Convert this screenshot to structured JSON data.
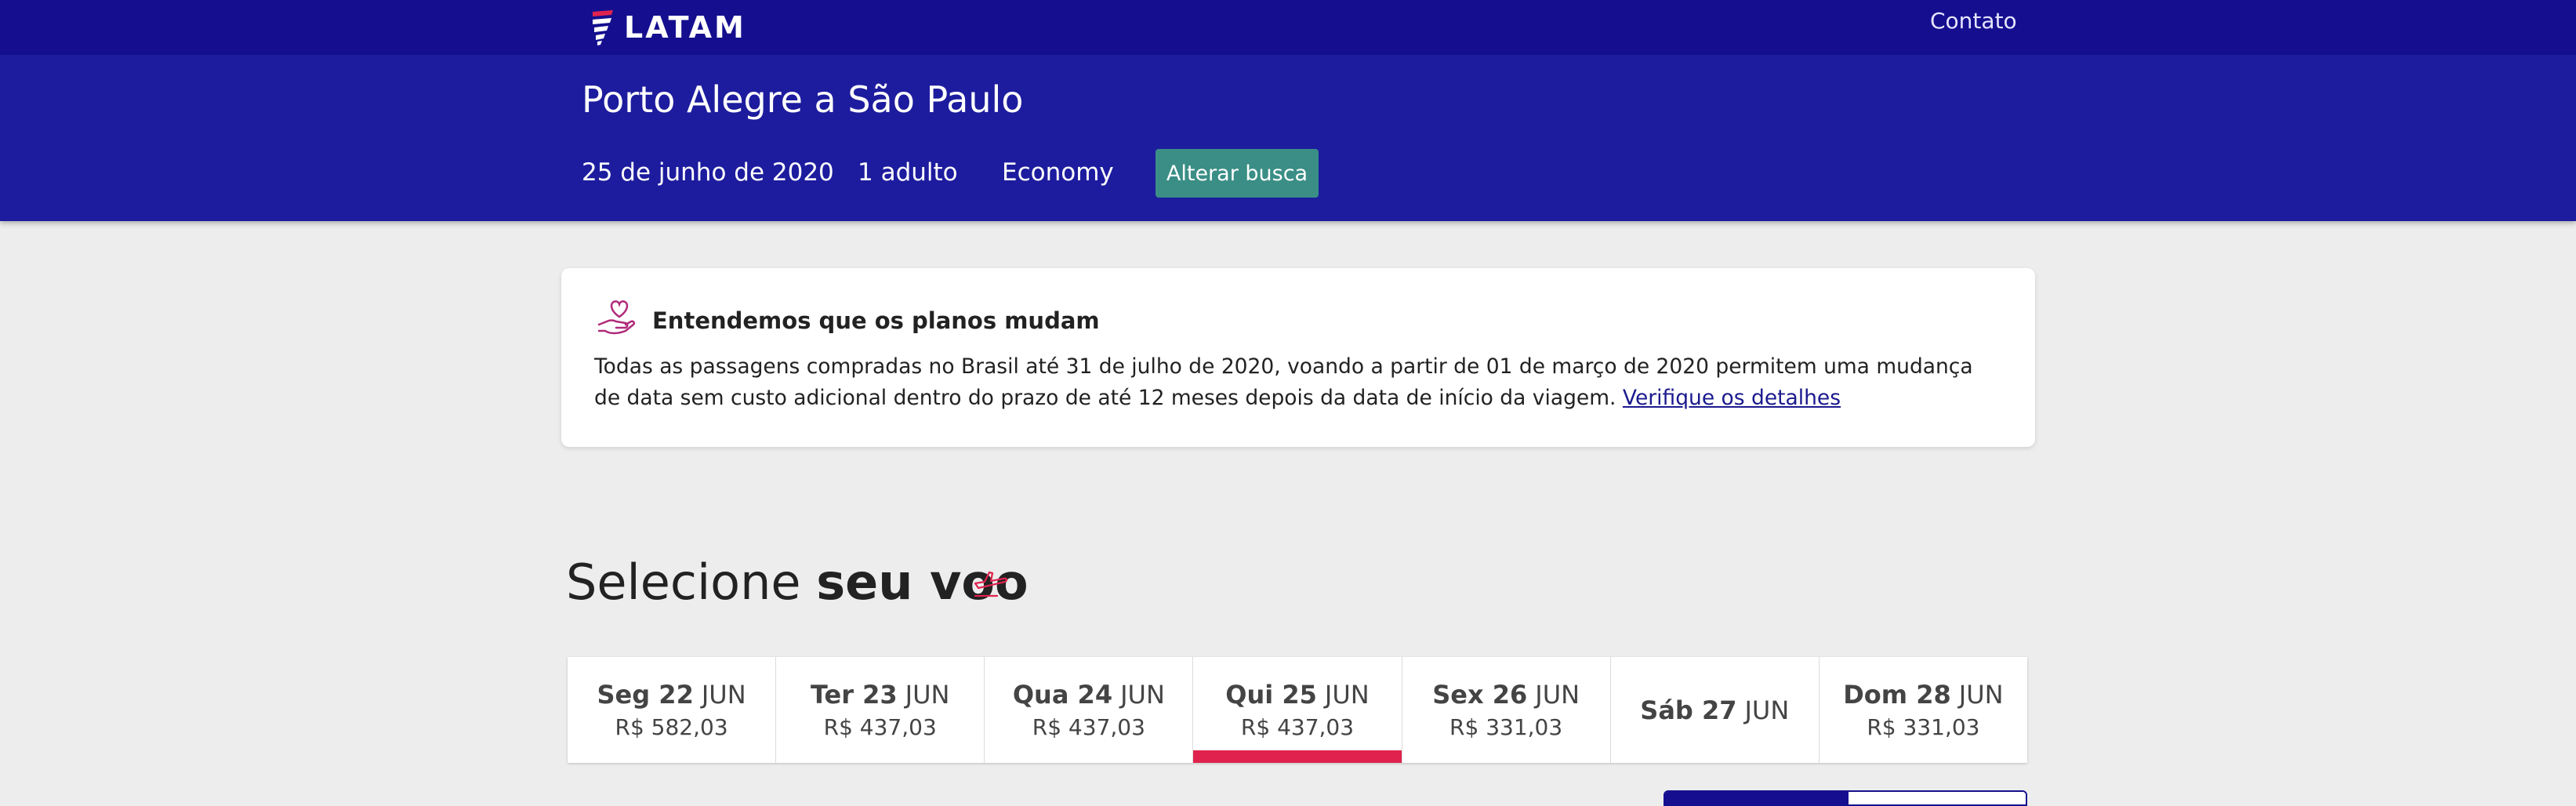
{
  "header": {
    "logo_text": "LATAM",
    "contact_label": "Contato",
    "bg_color": "#150f8f"
  },
  "search": {
    "route": "Porto Alegre a São Paulo",
    "date": "25 de junho de 2020",
    "passengers": "1 adulto",
    "cabin": "Economy",
    "alter_button": "Alterar busca"
  },
  "notice": {
    "icon": "heart-hand-icon",
    "title": "Entendemos que os planos mudam",
    "body": "Todas as passagens compradas no Brasil até 31 de julho de 2020, voando a partir de 01 de março de 2020 permitem uma mudança de data sem custo adicional dentro do prazo de até 12 meses depois da data de início da viagem.",
    "link": "Verifique os detalhes"
  },
  "select": {
    "title_regular": "Selecione",
    "title_bold": "seu voo",
    "icon": "plane-takeoff-icon"
  },
  "dates": [
    {
      "day": "Seg 22",
      "month": "JUN",
      "price": "R$ 582,03",
      "selected": false
    },
    {
      "day": "Ter 23",
      "month": "JUN",
      "price": "R$ 437,03",
      "selected": false
    },
    {
      "day": "Qua 24",
      "month": "JUN",
      "price": "R$ 437,03",
      "selected": false
    },
    {
      "day": "Qui 25",
      "month": "JUN",
      "price": "R$ 437,03",
      "selected": true
    },
    {
      "day": "Sex 26",
      "month": "JUN",
      "price": "R$ 331,03",
      "selected": false
    },
    {
      "day": "Sáb 27",
      "month": "JUN",
      "price": "",
      "selected": false
    },
    {
      "day": "Dom 28",
      "month": "JUN",
      "price": "R$ 331,03",
      "selected": false
    }
  ],
  "colors": {
    "summary_bg": "#1d1c9e",
    "button": "#3a8e86",
    "accent": "#e0234e"
  }
}
